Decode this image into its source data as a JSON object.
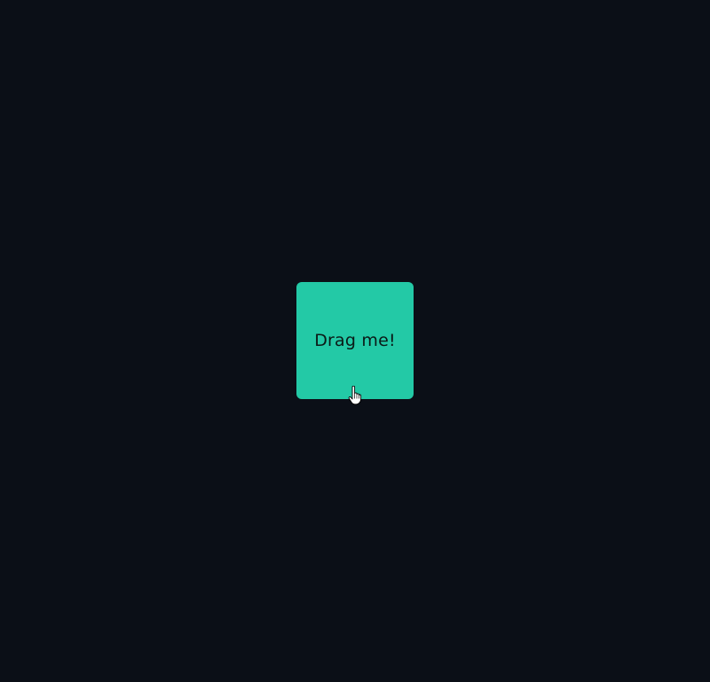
{
  "draggable": {
    "label": "Drag me!",
    "color": "#23c9a6"
  },
  "page": {
    "background": "#0b0f17"
  },
  "cursor": {
    "icon": "hand-pointer-icon"
  }
}
